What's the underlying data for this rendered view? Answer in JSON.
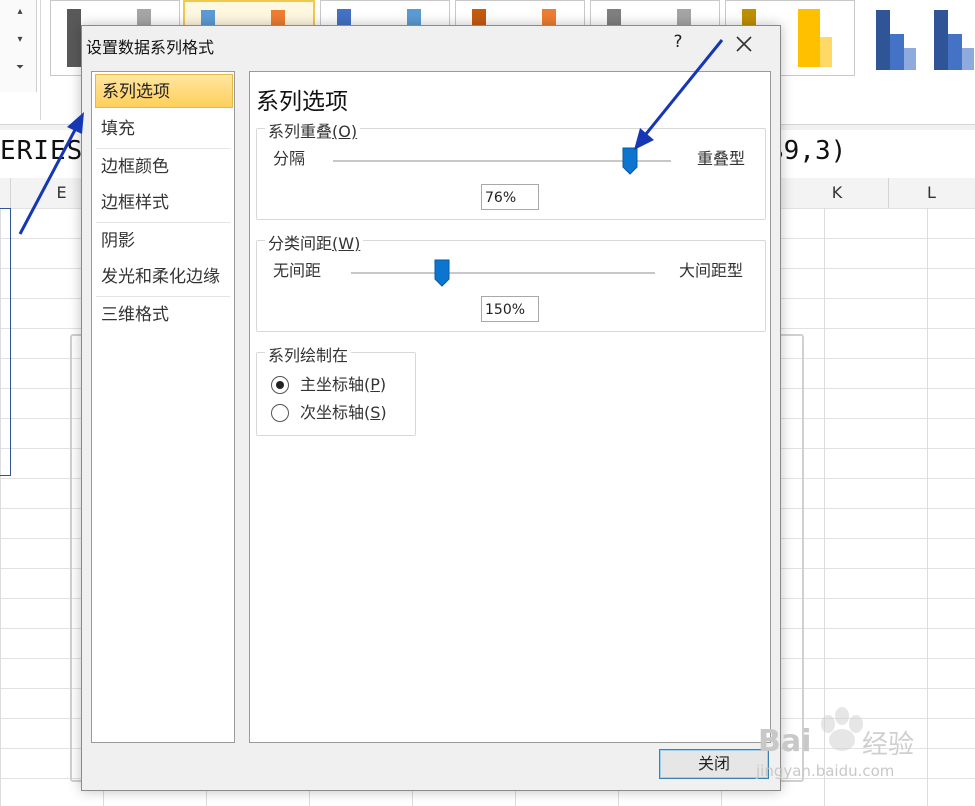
{
  "formula": {
    "left": "ERIES(",
    "right": "$9,3)"
  },
  "columns": [
    "E",
    "K",
    "L"
  ],
  "dialog": {
    "title": "设置数据系列格式",
    "help": "?",
    "nav": [
      "系列选项",
      "填充",
      "边框颜色",
      "边框样式",
      "阴影",
      "发光和柔化边缘",
      "三维格式"
    ],
    "content_title": "系列选项",
    "overlap": {
      "label": "系列重叠",
      "shortcut": "(O)",
      "shortcut_key": "O",
      "left": "分隔",
      "right": "重叠型",
      "value_text": "76%",
      "value": 76,
      "min": -100,
      "max": 100
    },
    "gap": {
      "label": "分类间距",
      "shortcut": "(W)",
      "shortcut_key": "W",
      "left": "无间距",
      "right": "大间距型",
      "value_text": "150%",
      "value": 150,
      "min": 0,
      "max": 500
    },
    "plot_on": {
      "label": "系列绘制在",
      "options": [
        {
          "text": "主坐标轴",
          "shortcut": "P",
          "checked": true
        },
        {
          "text": "次坐标轴",
          "shortcut": "S",
          "checked": false
        }
      ]
    },
    "close_button": "关闭"
  },
  "watermark": {
    "brand": "Bai",
    "brand_cn": "经验",
    "url": "jingyan.baidu.com"
  },
  "colors": {
    "accent": "#0b75d0",
    "arrow": "#1537b5",
    "nav_active": "#ffd766"
  }
}
